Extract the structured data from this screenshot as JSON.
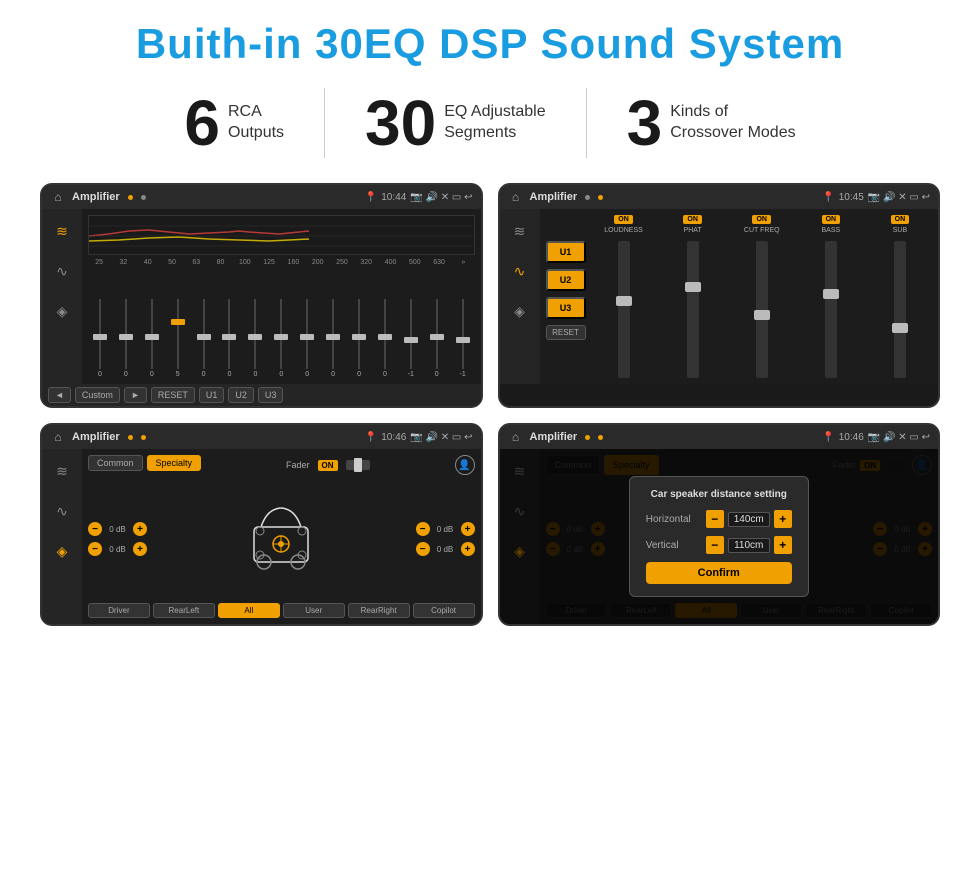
{
  "header": {
    "title": "Buith-in 30EQ DSP Sound System"
  },
  "stats": [
    {
      "number": "6",
      "label": "RCA\nOutputs"
    },
    {
      "number": "30",
      "label": "EQ Adjustable\nSegments"
    },
    {
      "number": "3",
      "label": "Kinds of\nCrossover Modes"
    }
  ],
  "screens": [
    {
      "id": "eq-screen",
      "status_bar": {
        "app": "Amplifier",
        "time": "10:44",
        "dot_color": "orange"
      },
      "eq_labels": [
        "25",
        "32",
        "40",
        "50",
        "63",
        "80",
        "100",
        "125",
        "160",
        "200",
        "250",
        "320",
        "400",
        "500",
        "630"
      ],
      "eq_values": [
        "0",
        "0",
        "0",
        "5",
        "0",
        "0",
        "0",
        "0",
        "0",
        "0",
        "0",
        "0",
        "-1",
        "0",
        "-1"
      ],
      "bottom_buttons": [
        "◄",
        "Custom",
        "►",
        "RESET",
        "U1",
        "U2",
        "U3"
      ]
    },
    {
      "id": "amp-screen",
      "status_bar": {
        "app": "Amplifier",
        "time": "10:45"
      },
      "presets": [
        "U1",
        "U2",
        "U3"
      ],
      "channels": [
        {
          "on": true,
          "label": "LOUDNESS"
        },
        {
          "on": true,
          "label": "PHAT"
        },
        {
          "on": true,
          "label": "CUT FREQ"
        },
        {
          "on": true,
          "label": "BASS"
        },
        {
          "on": true,
          "label": "SUB"
        }
      ],
      "reset_label": "RESET"
    },
    {
      "id": "speaker-screen",
      "status_bar": {
        "app": "Amplifier",
        "time": "10:46"
      },
      "tabs": [
        "Common",
        "Specialty"
      ],
      "fader_label": "Fader",
      "fader_on": "ON",
      "vol_rows": [
        {
          "val": "0 dB"
        },
        {
          "val": "0 dB"
        },
        {
          "val": "0 dB"
        },
        {
          "val": "0 dB"
        }
      ],
      "bottom_buttons": [
        "Driver",
        "RearLeft",
        "All",
        "User",
        "RearRight",
        "Copilot"
      ]
    },
    {
      "id": "dialog-screen",
      "status_bar": {
        "app": "Amplifier",
        "time": "10:46"
      },
      "tabs": [
        "Common",
        "Specialty"
      ],
      "dialog": {
        "title": "Car speaker distance setting",
        "rows": [
          {
            "label": "Horizontal",
            "value": "140cm"
          },
          {
            "label": "Vertical",
            "value": "110cm"
          }
        ],
        "confirm": "Confirm"
      },
      "side_labels": [
        "0 dB",
        "0 dB"
      ],
      "bottom_buttons": [
        "Driver",
        "RearLeft",
        "All",
        "User",
        "RearRight",
        "Copilot"
      ]
    }
  ]
}
